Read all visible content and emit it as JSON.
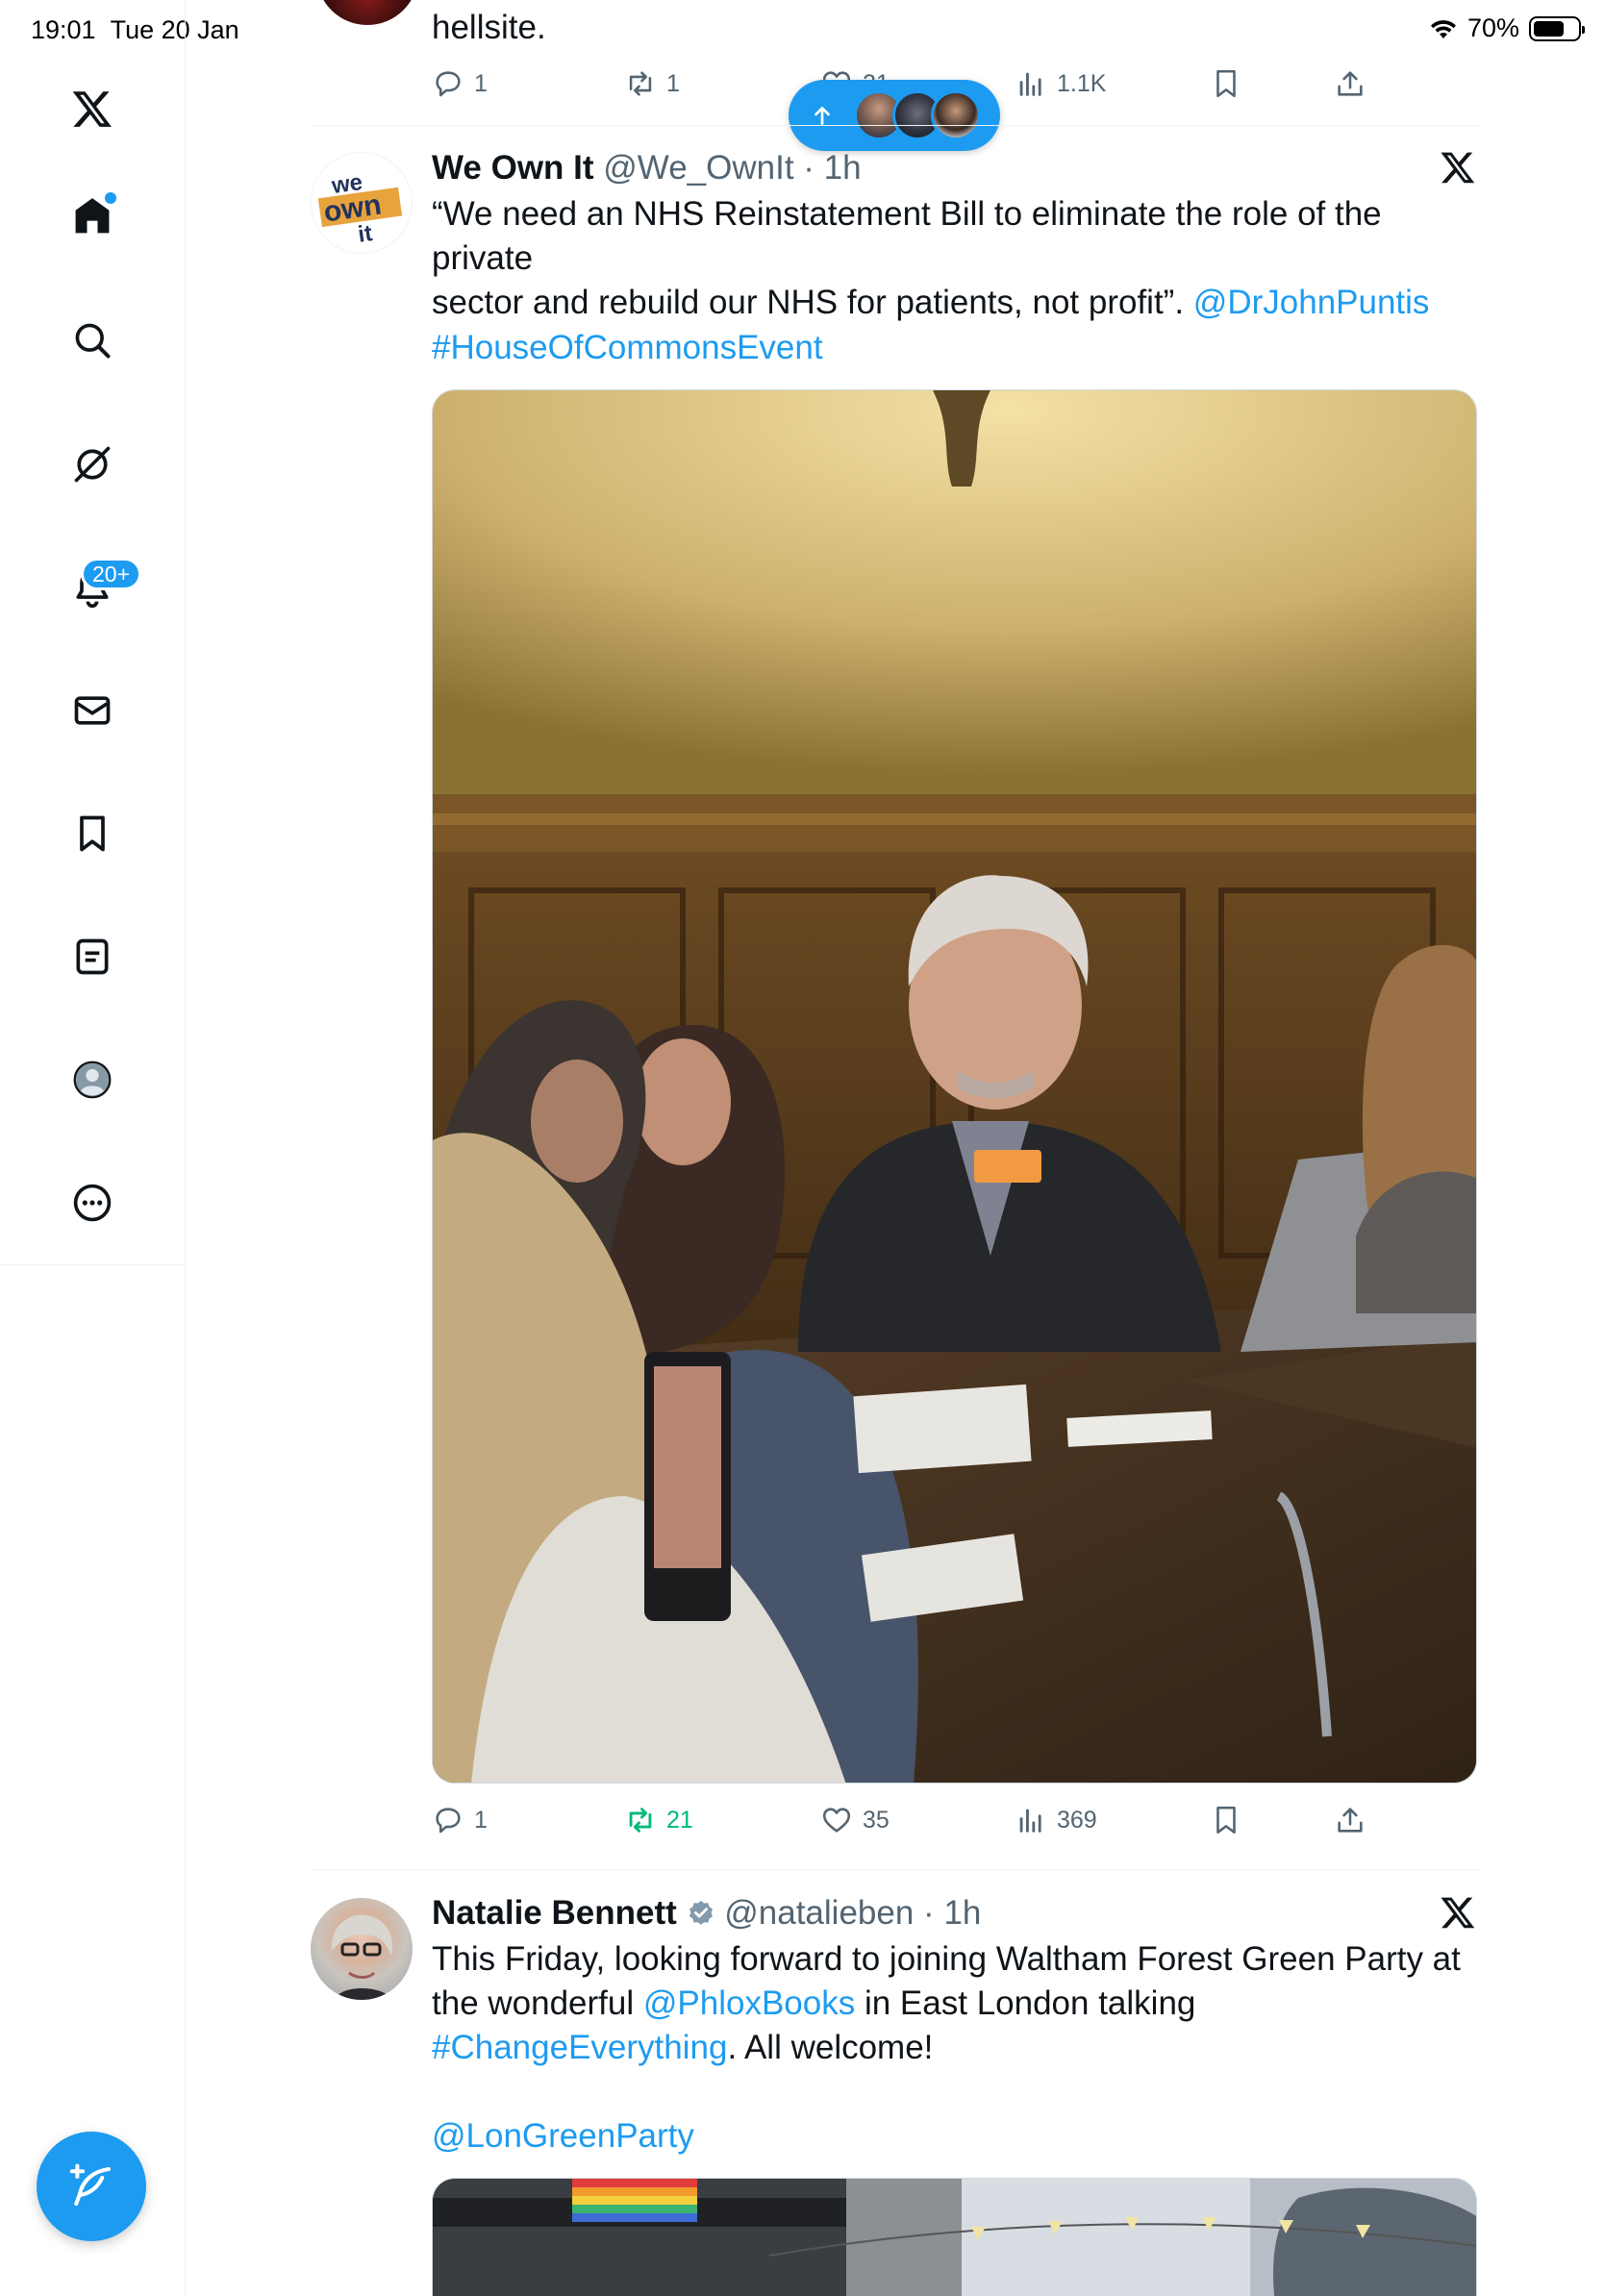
{
  "status_bar": {
    "time": "19:01",
    "date": "Tue 20 Jan",
    "battery": "70%",
    "battery_level": 0.7
  },
  "sidebar": {
    "items": [
      {
        "name": "home",
        "icon": "home-icon"
      },
      {
        "name": "search",
        "icon": "search-icon"
      },
      {
        "name": "grok",
        "icon": "grok-icon"
      },
      {
        "name": "notifications",
        "icon": "bell-icon",
        "badge": "20+"
      },
      {
        "name": "messages",
        "icon": "envelope-icon"
      },
      {
        "name": "bookmarks",
        "icon": "bookmark-icon"
      },
      {
        "name": "lists",
        "icon": "list-icon"
      },
      {
        "name": "profile",
        "icon": "avatar-icon"
      },
      {
        "name": "more",
        "icon": "more-icon"
      }
    ],
    "compose_icon": "feather-plus-icon"
  },
  "new_posts_pill": {
    "icon": "arrow-up-icon"
  },
  "tweets": [
    {
      "text_tail": "hellsite.",
      "stats": {
        "replies": "1",
        "reposts": "1",
        "likes": "21",
        "views": "1.1K"
      }
    },
    {
      "name": "We Own It",
      "handle": "@We_OwnIt",
      "time": "1h",
      "avatar_text": [
        "we",
        "own",
        "it"
      ],
      "body_line1": "“We need an NHS Reinstatement Bill to eliminate the role of the private",
      "body_line2": "sector and rebuild our NHS for patients, not profit”.",
      "mention": "@DrJohnPuntis",
      "hashtag": "#HouseOfCommonsEvent",
      "stats": {
        "replies": "1",
        "reposts": "21",
        "likes": "35",
        "views": "369"
      }
    },
    {
      "name": "Natalie Bennett",
      "handle": "@natalieben",
      "time": "1h",
      "body_line1": "This Friday, looking forward to joining Waltham Forest Green Party at",
      "body_line2_pre": "the wonderful",
      "mention1": "@PhloxBooks",
      "body_line2_post": "in East London talking",
      "hashtag": "#ChangeEverything",
      "body_line3_post": ". All welcome!",
      "mention2": "@LonGreenParty"
    }
  ],
  "colors": {
    "accent": "#1d9bf0",
    "text": "#0f1419",
    "muted": "#536471",
    "repost_active": "#00ba7c"
  }
}
